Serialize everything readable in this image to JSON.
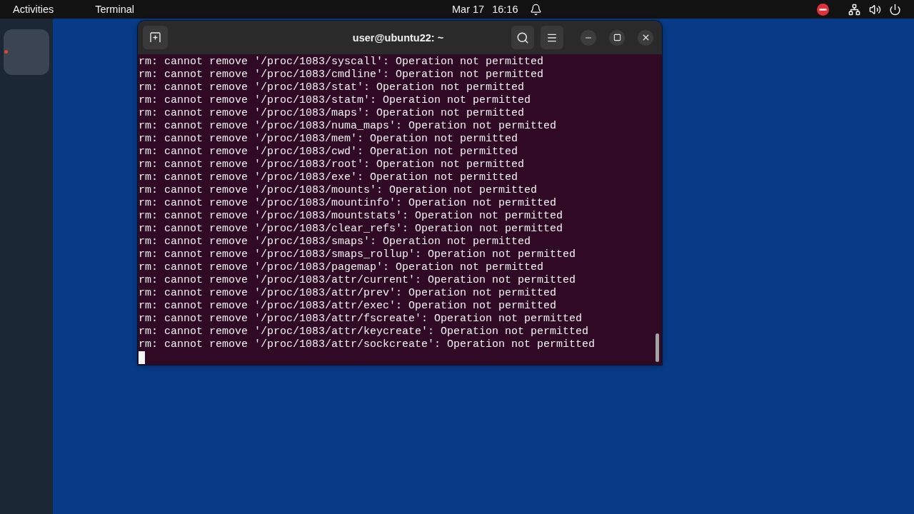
{
  "top_bar": {
    "activities": "Activities",
    "app_menu": "Terminal",
    "date": "Mar 17",
    "time": "16:16"
  },
  "dock": {
    "apps": [
      {
        "running": true
      }
    ]
  },
  "terminal": {
    "title": "user@ubuntu22: ~",
    "lines": [
      "rm: cannot remove '/proc/1083/syscall': Operation not permitted",
      "rm: cannot remove '/proc/1083/cmdline': Operation not permitted",
      "rm: cannot remove '/proc/1083/stat': Operation not permitted",
      "rm: cannot remove '/proc/1083/statm': Operation not permitted",
      "rm: cannot remove '/proc/1083/maps': Operation not permitted",
      "rm: cannot remove '/proc/1083/numa_maps': Operation not permitted",
      "rm: cannot remove '/proc/1083/mem': Operation not permitted",
      "rm: cannot remove '/proc/1083/cwd': Operation not permitted",
      "rm: cannot remove '/proc/1083/root': Operation not permitted",
      "rm: cannot remove '/proc/1083/exe': Operation not permitted",
      "rm: cannot remove '/proc/1083/mounts': Operation not permitted",
      "rm: cannot remove '/proc/1083/mountinfo': Operation not permitted",
      "rm: cannot remove '/proc/1083/mountstats': Operation not permitted",
      "rm: cannot remove '/proc/1083/clear_refs': Operation not permitted",
      "rm: cannot remove '/proc/1083/smaps': Operation not permitted",
      "rm: cannot remove '/proc/1083/smaps_rollup': Operation not permitted",
      "rm: cannot remove '/proc/1083/pagemap': Operation not permitted",
      "rm: cannot remove '/proc/1083/attr/current': Operation not permitted",
      "rm: cannot remove '/proc/1083/attr/prev': Operation not permitted",
      "rm: cannot remove '/proc/1083/attr/exec': Operation not permitted",
      "rm: cannot remove '/proc/1083/attr/fscreate': Operation not permitted",
      "rm: cannot remove '/proc/1083/attr/keycreate': Operation not permitted",
      "rm: cannot remove '/proc/1083/attr/sockcreate': Operation not permitted"
    ]
  }
}
